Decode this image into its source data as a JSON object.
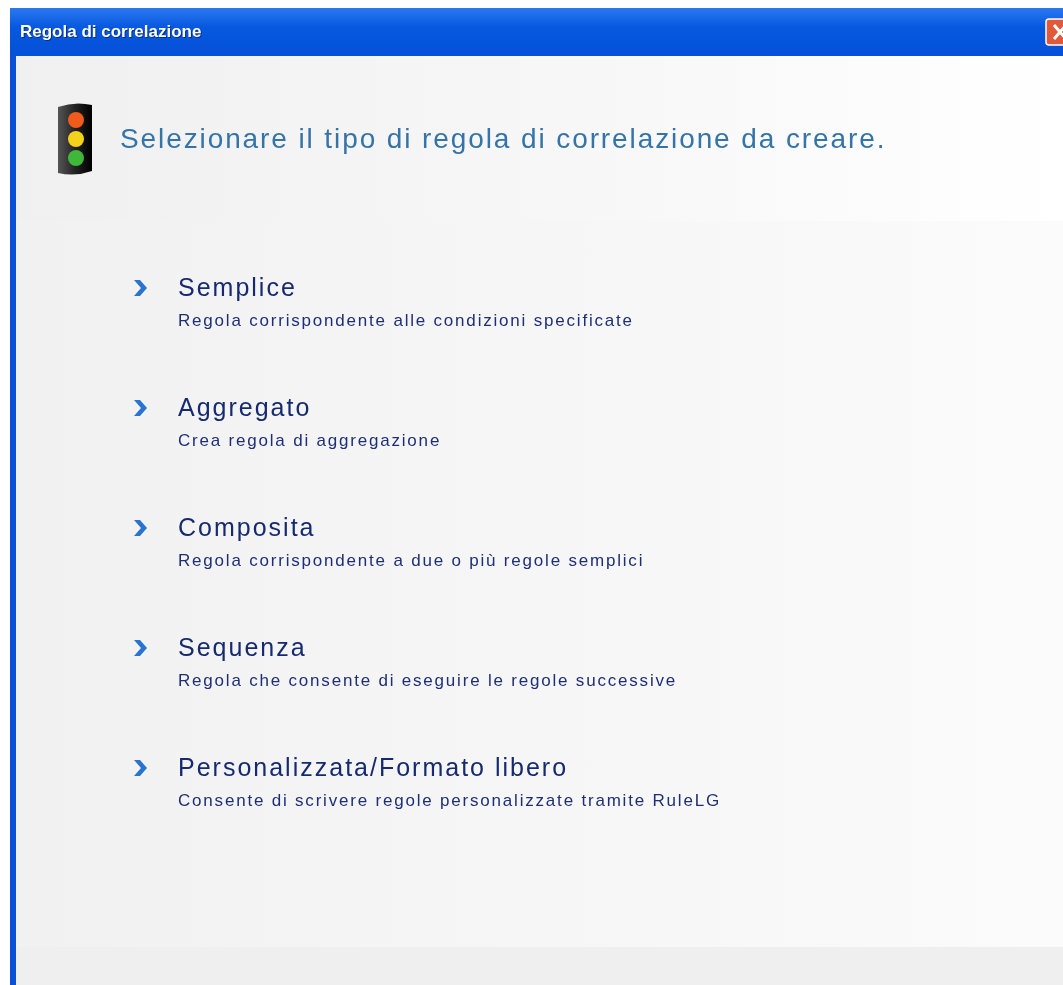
{
  "window": {
    "title": "Regola di correlazione"
  },
  "heading": "Selezionare il tipo di regola di correlazione da creare.",
  "options": [
    {
      "title": "Semplice",
      "description": "Regola corrispondente alle condizioni specificate"
    },
    {
      "title": "Aggregato",
      "description": "Crea regola di aggregazione"
    },
    {
      "title": "Composita",
      "description": "Regola corrispondente a due o più regole semplici"
    },
    {
      "title": "Sequenza",
      "description": "Regola che consente di eseguire le regole successive"
    },
    {
      "title": "Personalizzata/Formato libero",
      "description": "Consente di scrivere regole personalizzate tramite RuleLG"
    }
  ]
}
